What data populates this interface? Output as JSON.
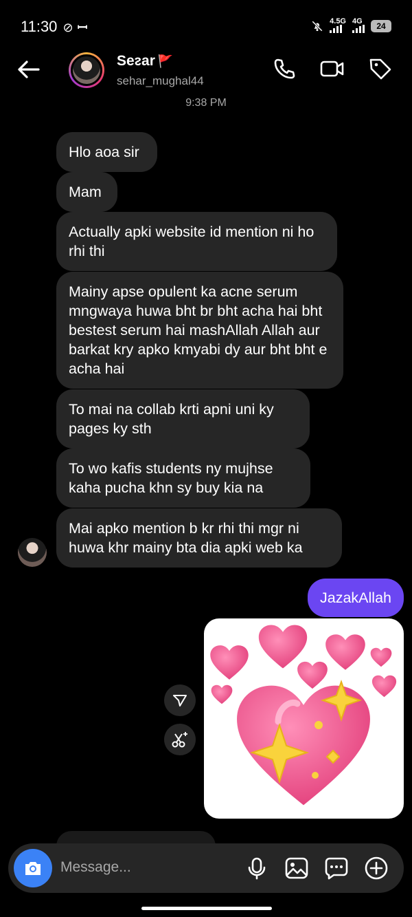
{
  "status_bar": {
    "time": "11:30",
    "signal1_label": "4.5G",
    "signal2_label": "4G",
    "battery": "24"
  },
  "header": {
    "name": "Seᴤar",
    "flag": "🚩",
    "username": "sehar_mughal44"
  },
  "timestamp": "9:38 PM",
  "messages_received": [
    "Hlo aoa sir",
    "Mam",
    "Actually apki website id mention ni ho rhi thi",
    "Mainy apse opulent ka acne serum mngwaya huwa bht br bht acha hai bht bestest serum hai mashAllah Allah aur barkat kry apko kmyabi dy aur bht bht e acha hai",
    "To mai na collab krti apni uni ky pages ky sth",
    "To wo kafis students ny mujhse kaha pucha khn sy buy kia na",
    "Mai apko mention b kr rhi thi mgr ni huwa khr mainy bta dia apki web ka"
  ],
  "messages_sent": [
    "JazakAllah"
  ],
  "sticker": "pink-hearts-sparkles",
  "composer": {
    "placeholder": "Message..."
  },
  "colors": {
    "background": "#000000",
    "received_bubble": "#262626",
    "sent_bubble": "#6b46f2",
    "camera_button": "#3b82f6",
    "heart": "#ef5d91"
  }
}
